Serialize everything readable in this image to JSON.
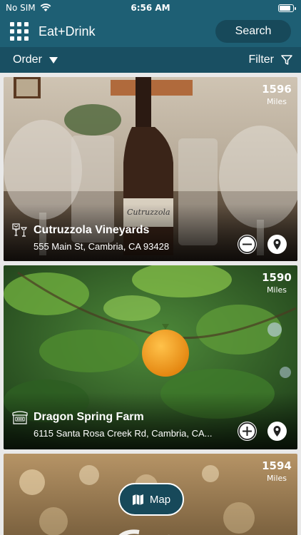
{
  "status_bar": {
    "carrier": "No SIM",
    "time": "6:56 AM",
    "battery_level": 0.9
  },
  "header": {
    "title": "Eat+Drink",
    "search_label": "Search"
  },
  "toolbar": {
    "order_label": "Order",
    "filter_label": "Filter"
  },
  "listings": [
    {
      "name": "Cutruzzola Vineyards",
      "address": "555 Main St, Cambria, CA 93428",
      "distance": "1596",
      "unit": "Miles",
      "category_icon": "wine-glasses-icon",
      "action": "remove"
    },
    {
      "name": "Dragon Spring Farm",
      "address": "6115 Santa Rosa Creek Rd, Cambria, CA...",
      "distance": "1590",
      "unit": "Miles",
      "category_icon": "farm-stand-icon",
      "action": "add"
    },
    {
      "name": "",
      "address": "",
      "distance": "1594",
      "unit": "Miles"
    }
  ],
  "map_button": {
    "label": "Map"
  },
  "colors": {
    "header_bg": "#1e5f74",
    "subbar_bg": "#194f62",
    "button_bg": "#17495a"
  }
}
